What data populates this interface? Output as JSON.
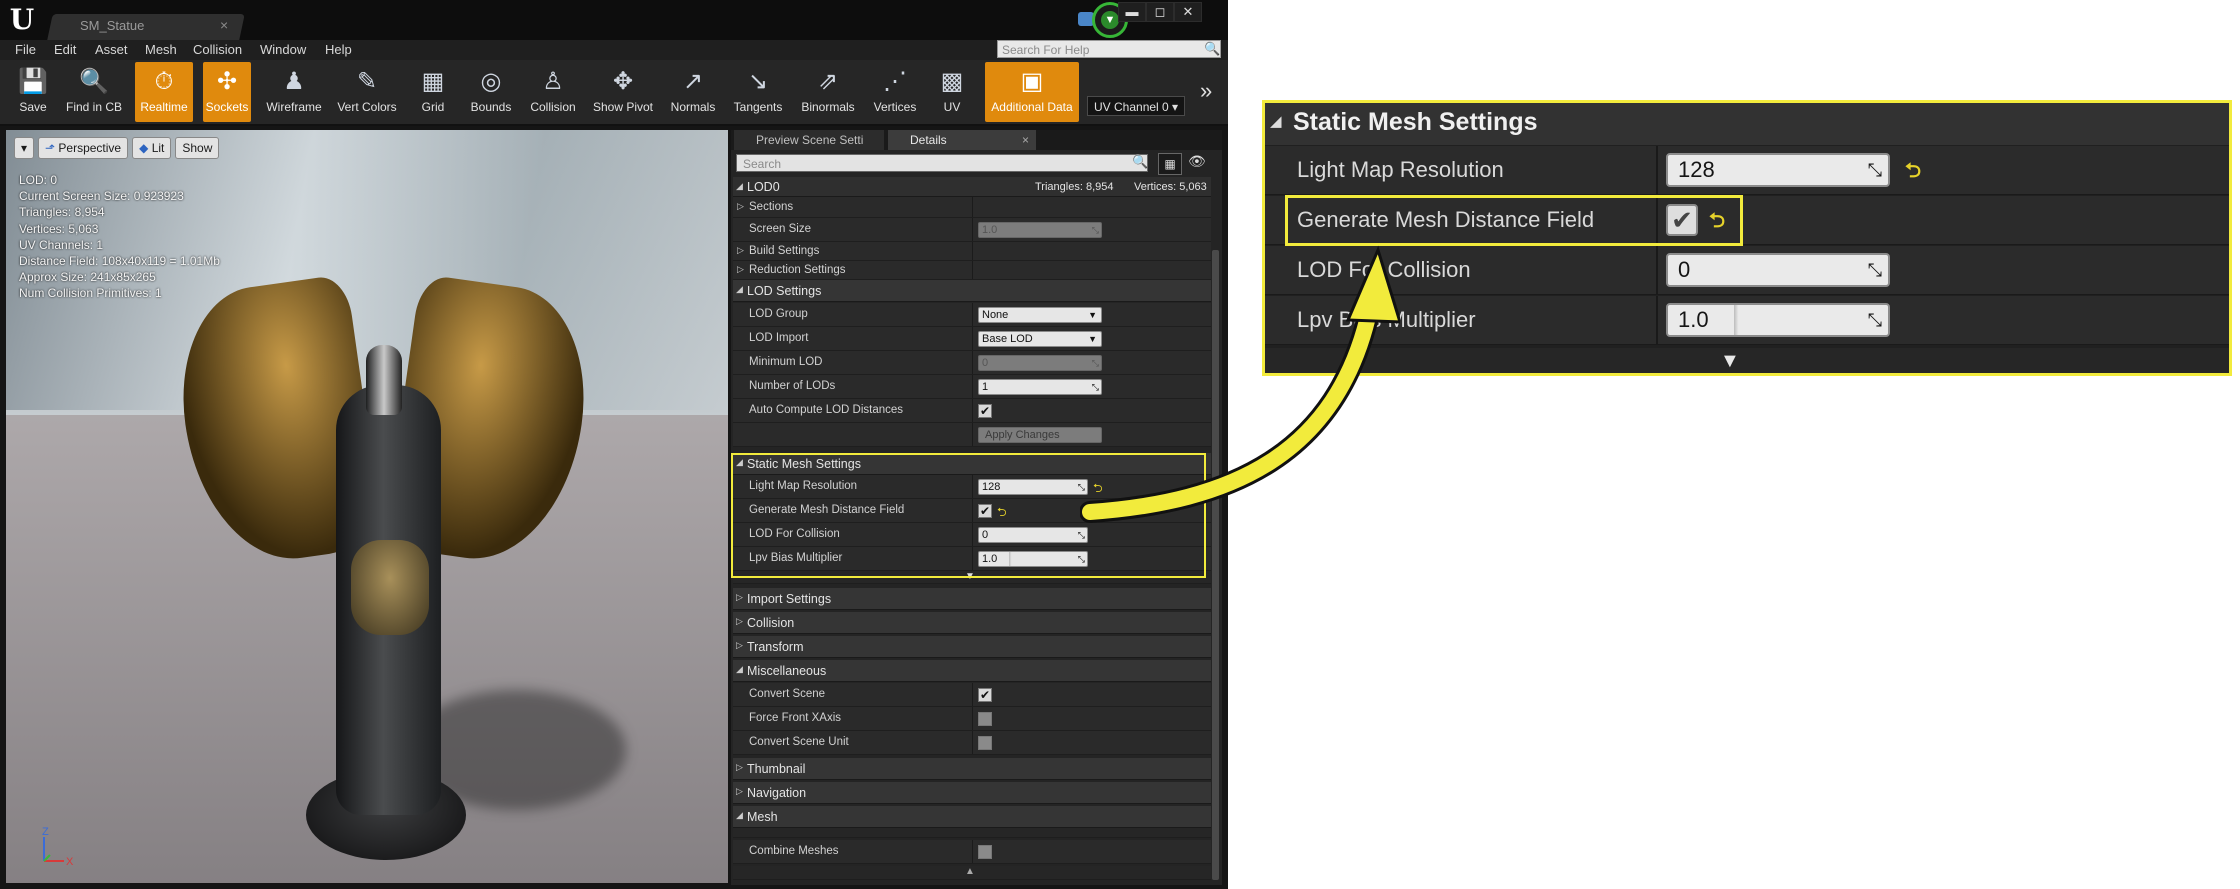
{
  "titlebar": {
    "tab_label": "SM_Statue",
    "tab_close": "×",
    "min": "▬",
    "max": "◻",
    "close": "✕",
    "logo": "U",
    "source_icon": "▼"
  },
  "menu": [
    "File",
    "Edit",
    "Asset",
    "Mesh",
    "Collision",
    "Window",
    "Help"
  ],
  "search_help_placeholder": "Search For Help",
  "toolbar": {
    "buttons": [
      {
        "label": "Save",
        "icon": "💾"
      },
      {
        "label": "Find in CB",
        "icon": "🔍"
      },
      {
        "label": "Realtime",
        "icon": "⏱"
      },
      {
        "label": "Sockets",
        "icon": "✣"
      },
      {
        "label": "Wireframe",
        "icon": "♟"
      },
      {
        "label": "Vert Colors",
        "icon": "✎"
      },
      {
        "label": "Grid",
        "icon": "▦"
      },
      {
        "label": "Bounds",
        "icon": "◎"
      },
      {
        "label": "Collision",
        "icon": "♙"
      },
      {
        "label": "Show Pivot",
        "icon": "✥"
      },
      {
        "label": "Normals",
        "icon": "↗"
      },
      {
        "label": "Tangents",
        "icon": "↘"
      },
      {
        "label": "Binormals",
        "icon": "⇗"
      },
      {
        "label": "Vertices",
        "icon": "⋰"
      },
      {
        "label": "UV",
        "icon": "▩"
      },
      {
        "label": "Additional Data",
        "icon": "▣"
      }
    ],
    "uv_channel": "UV Channel 0",
    "more": "»"
  },
  "viewport": {
    "menu_arrow": "▾",
    "perspective": "Perspective",
    "lit": "Lit",
    "show": "Show",
    "stats": [
      "LOD:  0",
      "Current Screen Size:  0.923923",
      "Triangles:  8,954",
      "Vertices:  5,063",
      "UV Channels:  1",
      "Distance Field:  108x40x119 = 1.01Mb",
      "Approx Size: 241x85x265",
      "Num Collision Primitives:  1"
    ],
    "axis_z": "Z",
    "axis_x": "X"
  },
  "details": {
    "tab_preview": "Preview Scene Setti",
    "tab_details": "Details",
    "tab_close": "×",
    "search_placeholder": "Search",
    "lod0": {
      "label": "LOD0",
      "triangles": "Triangles: 8,954",
      "vertices": "Vertices: 5,063"
    },
    "lod0_rows": {
      "sections": "Sections",
      "screen_size": "Screen Size",
      "screen_size_value": "1.0",
      "build_settings": "Build Settings",
      "reduction_settings": "Reduction Settings"
    },
    "lod_settings": {
      "label": "LOD Settings",
      "lod_group": "LOD Group",
      "lod_group_value": "None",
      "lod_import": "LOD Import",
      "lod_import_value": "Base LOD",
      "minimum_lod": "Minimum LOD",
      "minimum_lod_value": "0",
      "number_of_lods": "Number of LODs",
      "number_of_lods_value": "1",
      "auto_compute": "Auto Compute LOD Distances",
      "apply_changes": "Apply Changes"
    },
    "static_mesh_settings": {
      "label": "Static Mesh Settings",
      "light_map_resolution": "Light Map Resolution",
      "light_map_resolution_value": "128",
      "generate_mesh_distance_field": "Generate Mesh Distance Field",
      "lod_for_collision": "LOD For Collision",
      "lod_for_collision_value": "0",
      "lpv_bias_multiplier": "Lpv Bias Multiplier",
      "lpv_bias_multiplier_value": "1.0"
    },
    "import_settings": "Import Settings",
    "collision": "Collision",
    "transform": "Transform",
    "miscellaneous": {
      "label": "Miscellaneous",
      "convert_scene": "Convert Scene",
      "force_front_xaxis": "Force Front XAxis",
      "convert_scene_unit": "Convert Scene Unit"
    },
    "thumbnail": "Thumbnail",
    "navigation": "Navigation",
    "mesh": {
      "label": "Mesh",
      "combine_meshes": "Combine Meshes"
    }
  },
  "zoom": {
    "header": "Static Mesh Settings",
    "light_map_resolution": "Light Map Resolution",
    "light_map_resolution_value": "128",
    "generate_mesh_distance_field": "Generate Mesh Distance Field",
    "lod_for_collision": "LOD For Collision",
    "lod_for_collision_value": "0",
    "lpv_bias_multiplier": "Lpv Bias Multiplier",
    "lpv_bias_multiplier_value": "1.0"
  },
  "icons": {
    "check": "✔",
    "reset": "⮌",
    "corner": "⤡",
    "expanded": "◢",
    "collapsed": "▷",
    "search": "🔍",
    "grid": "▦",
    "eye": "👁"
  },
  "colors": {
    "accent_orange": "#e08a0d",
    "highlight_yellow": "#f2eb3c",
    "reset_yellow": "#e6d22a",
    "source_green": "#37b637"
  }
}
